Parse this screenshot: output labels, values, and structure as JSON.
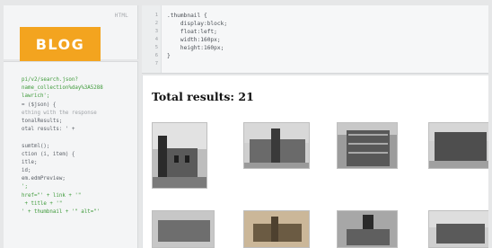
{
  "html_panel": {
    "tag": "HTML"
  },
  "badge": {
    "label": "BLOG"
  },
  "css_panel": {
    "lines": [
      {
        "num": "1",
        "text": ".thumbnail {"
      },
      {
        "num": "2",
        "text": "    display:block;"
      },
      {
        "num": "3",
        "text": "    float:left;"
      },
      {
        "num": "4",
        "text": "    width:160px;"
      },
      {
        "num": "5",
        "text": "    height:160px;"
      },
      {
        "num": "6",
        "text": "}"
      },
      {
        "num": "7",
        "text": ""
      }
    ]
  },
  "js_panel": {
    "lines": [
      "pi/v2/search.json?",
      "name_collection%day%3A5288",
      "lawrich';",
      "= ($json) {",
      "ething with the response",
      "tonalResults;",
      "otal results: ' +",
      "",
      "sumtml();",
      "ction (i, item) {",
      "itle;",
      "id;",
      "em.edmPreview;",
      "';",
      "href=\"' + link + '\"",
      " + title + '\"",
      "' + thumbnail + '\" alt=\"'"
    ]
  },
  "result_panel": {
    "total_label": "Total results: 21"
  }
}
